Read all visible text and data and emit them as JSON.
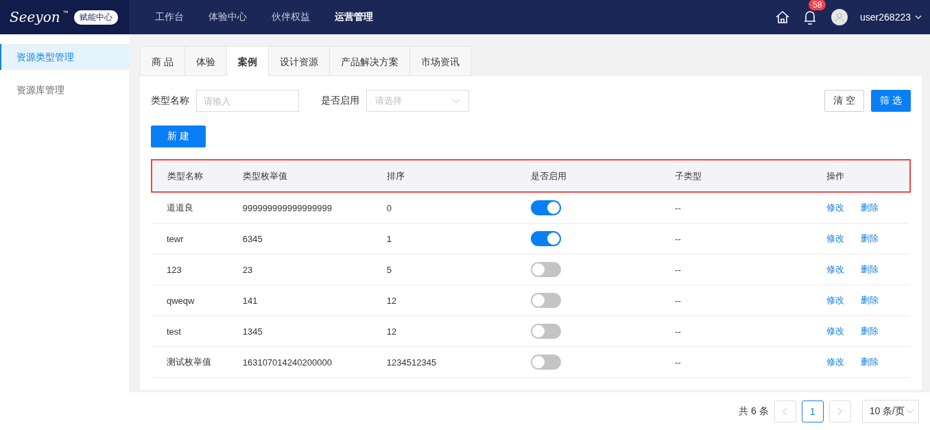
{
  "header": {
    "logo_text": "Seeyon",
    "logo_tm": "™",
    "logo_badge": "赋能中心",
    "nav": [
      {
        "label": "工作台",
        "selected": false
      },
      {
        "label": "体验中心",
        "selected": false
      },
      {
        "label": "伙伴权益",
        "selected": false
      },
      {
        "label": "运营管理",
        "selected": true
      }
    ],
    "notification_count": "58",
    "username": "user268223"
  },
  "sidebar": {
    "items": [
      {
        "label": "资源类型管理",
        "selected": true
      },
      {
        "label": "资源库管理",
        "selected": false
      }
    ]
  },
  "tabs": [
    {
      "label": "商 品",
      "selected": false
    },
    {
      "label": "体验",
      "selected": false
    },
    {
      "label": "案例",
      "selected": true
    },
    {
      "label": "设计资源",
      "selected": false
    },
    {
      "label": "产品解决方案",
      "selected": false
    },
    {
      "label": "市场资讯",
      "selected": false
    }
  ],
  "filters": {
    "name_label": "类型名称",
    "name_placeholder": "请输入",
    "enabled_label": "是否启用",
    "enabled_placeholder": "请选择",
    "clear_button": "清 空",
    "filter_button": "筛 选"
  },
  "new_button": "新 建",
  "table": {
    "columns": [
      "类型名称",
      "类型枚举值",
      "排序",
      "是否启用",
      "子类型",
      "操作"
    ],
    "rows": [
      {
        "name": "道道良",
        "value": "999999999999999999",
        "order": "0",
        "enabled": true,
        "subtype": "--",
        "edit": "修改",
        "delete": "删除"
      },
      {
        "name": "tewr",
        "value": "6345",
        "order": "1",
        "enabled": true,
        "subtype": "--",
        "edit": "修改",
        "delete": "删除"
      },
      {
        "name": "123",
        "value": "23",
        "order": "5",
        "enabled": false,
        "subtype": "--",
        "edit": "修改",
        "delete": "删除"
      },
      {
        "name": "qweqw",
        "value": "141",
        "order": "12",
        "enabled": false,
        "subtype": "--",
        "edit": "修改",
        "delete": "删除"
      },
      {
        "name": "test",
        "value": "1345",
        "order": "12",
        "enabled": false,
        "subtype": "--",
        "edit": "修改",
        "delete": "删除"
      },
      {
        "name": "测试枚举值",
        "value": "163107014240200000",
        "order": "1234512345",
        "enabled": false,
        "subtype": "--",
        "edit": "修改",
        "delete": "删除"
      }
    ]
  },
  "pagination": {
    "total": "共 6 条",
    "pages": [
      {
        "label": "1",
        "selected": true
      }
    ],
    "page_size": "10 条/页"
  }
}
